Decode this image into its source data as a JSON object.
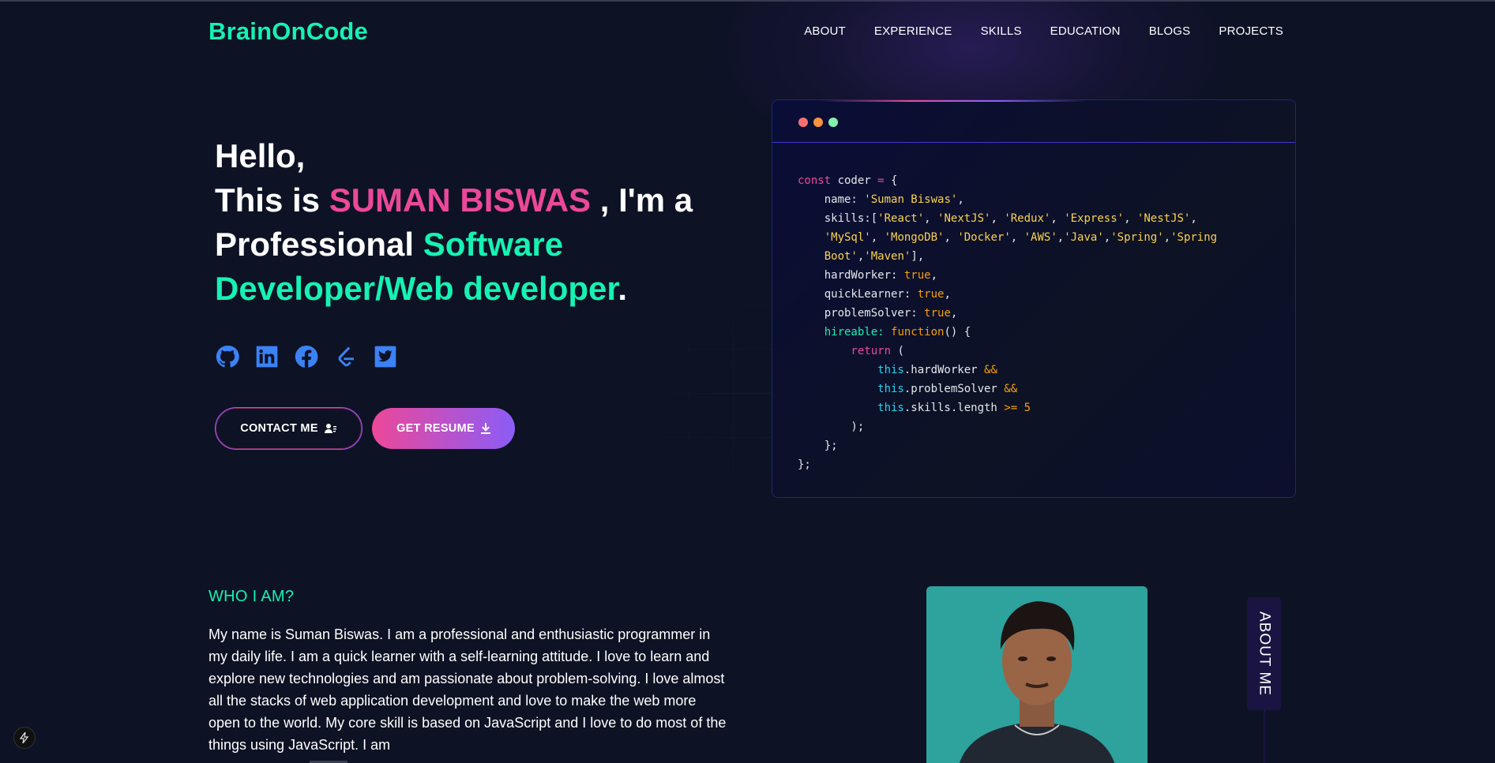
{
  "brand": "BrainOnCode",
  "nav": [
    "ABOUT",
    "EXPERIENCE",
    "SKILLS",
    "EDUCATION",
    "BLOGS",
    "PROJECTS"
  ],
  "hero": {
    "hello": "Hello,",
    "line2_prefix": "This is ",
    "name": "SUMAN BISWAS",
    "line2_suffix": " , I'm a",
    "line3_prefix": "Professional ",
    "role": "Software Developer/Web developer",
    "period": "."
  },
  "socials": [
    "github-icon",
    "linkedin-icon",
    "facebook-icon",
    "leetcode-icon",
    "twitter-icon"
  ],
  "buttons": {
    "contact": "CONTACT ME",
    "resume": "GET RESUME"
  },
  "code_window": {
    "dot_colors": [
      "#f87171",
      "#fb923c",
      "#86efac"
    ],
    "lines": [
      [
        [
          "k",
          "const "
        ],
        [
          "o",
          "coder "
        ],
        [
          "k",
          "= "
        ],
        [
          "o",
          "{"
        ]
      ],
      [
        [
          "o",
          "    name: "
        ],
        [
          "s",
          "'Suman Biswas'"
        ],
        [
          "o",
          ","
        ]
      ],
      [
        [
          "o",
          "    skills:["
        ],
        [
          "s",
          "'React'"
        ],
        [
          "o",
          ", "
        ],
        [
          "s",
          "'NextJS'"
        ],
        [
          "o",
          ", "
        ],
        [
          "s",
          "'Redux'"
        ],
        [
          "o",
          ", "
        ],
        [
          "s",
          "'Express'"
        ],
        [
          "o",
          ", "
        ],
        [
          "s",
          "'NestJS'"
        ],
        [
          "o",
          ","
        ]
      ],
      [
        [
          "o",
          "    "
        ],
        [
          "s",
          "'MySql'"
        ],
        [
          "o",
          ", "
        ],
        [
          "s",
          "'MongoDB'"
        ],
        [
          "o",
          ", "
        ],
        [
          "s",
          "'Docker'"
        ],
        [
          "o",
          ", "
        ],
        [
          "s",
          "'AWS'"
        ],
        [
          "o",
          ","
        ],
        [
          "s",
          "'Java'"
        ],
        [
          "o",
          ","
        ],
        [
          "s",
          "'Spring'"
        ],
        [
          "o",
          ","
        ],
        [
          "s",
          "'Spring"
        ]
      ],
      [
        [
          "s",
          "    Boot'"
        ],
        [
          "o",
          ","
        ],
        [
          "s",
          "'Maven'"
        ],
        [
          "o",
          "],"
        ]
      ],
      [
        [
          "o",
          "    hardWorker: "
        ],
        [
          "t",
          "true"
        ],
        [
          "o",
          ","
        ]
      ],
      [
        [
          "o",
          "    quickLearner: "
        ],
        [
          "t",
          "true"
        ],
        [
          "o",
          ","
        ]
      ],
      [
        [
          "o",
          "    problemSolver: "
        ],
        [
          "t",
          "true"
        ],
        [
          "o",
          ","
        ]
      ],
      [
        [
          "g",
          "    hireable: "
        ],
        [
          "t",
          "function"
        ],
        [
          "o",
          "() {"
        ]
      ],
      [
        [
          "k",
          "        return "
        ],
        [
          "o",
          "("
        ]
      ],
      [
        [
          "c",
          "            this"
        ],
        [
          "o",
          ".hardWorker "
        ],
        [
          "t",
          "&&"
        ]
      ],
      [
        [
          "c",
          "            this"
        ],
        [
          "o",
          ".problemSolver "
        ],
        [
          "t",
          "&&"
        ]
      ],
      [
        [
          "c",
          "            this"
        ],
        [
          "o",
          ".skills.length "
        ],
        [
          "t",
          ">= "
        ],
        [
          "t",
          "5"
        ]
      ],
      [
        [
          "o",
          "        );"
        ]
      ],
      [
        [
          "o",
          "    };"
        ]
      ],
      [
        [
          "o",
          "};"
        ]
      ]
    ]
  },
  "about": {
    "heading": "WHO I AM?",
    "text": "My name is Suman Biswas. I am a professional and enthusiastic programmer in my daily life. I am a quick learner with a self-learning attitude. I love to learn and explore new technologies and am passionate about problem-solving. I love almost all the stacks of web application development and love to make the web more open to the world. My core skill is based on JavaScript and I love to do most of the things using JavaScript. I am",
    "tab": "ABOUT ME"
  }
}
